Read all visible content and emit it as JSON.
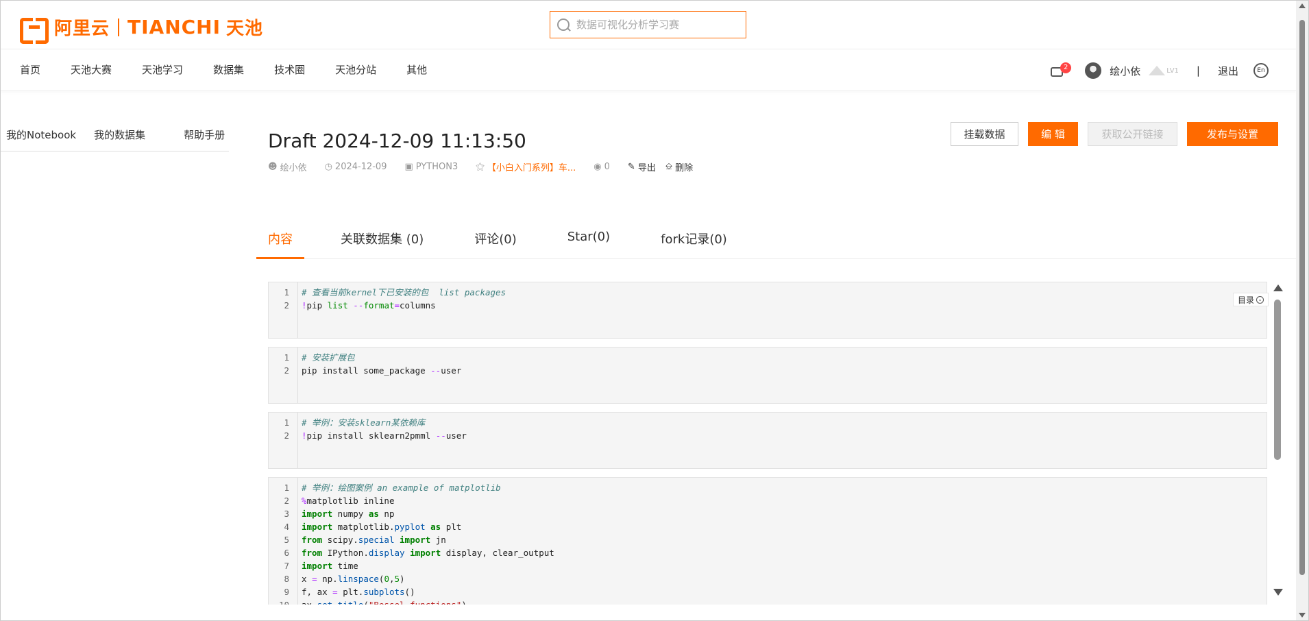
{
  "header": {
    "logo_cn": "阿里云",
    "logo_en": "TIANCHI",
    "logo_en_cn": "天池",
    "search_placeholder": "数据可视化分析学习赛"
  },
  "nav": {
    "items": [
      "首页",
      "天池大赛",
      "天池学习",
      "数据集",
      "技术圈",
      "天池分站",
      "其他"
    ],
    "message_count": "2",
    "username": "绘小依",
    "level": "LV1",
    "divider": "|",
    "logout": "退出",
    "lang": "En"
  },
  "sidebar": {
    "tabs": [
      "我的Notebook",
      "我的数据集",
      "帮助手册"
    ]
  },
  "doc": {
    "title": "Draft 2024-12-09 11:13:50",
    "author": "绘小依",
    "date": "2024-12-09",
    "kernel": "PYTHON3",
    "competition": "【小白入门系列】车...",
    "views": "0",
    "export": "导出",
    "delete": "删除"
  },
  "actions": {
    "mount": "挂载数据",
    "edit": "编 辑",
    "public_link": "获取公开链接",
    "publish": "发布与设置"
  },
  "tabs": [
    "内容",
    "关联数据集 (0)",
    "评论(0)",
    "Star(0)",
    "fork记录(0)"
  ],
  "toc_label": "目录",
  "colors": {
    "accent": "#ff6a00"
  },
  "icons": {
    "author": "user-icon",
    "date": "clock-icon",
    "kernel": "terminal-icon",
    "competition": "trophy-icon",
    "views": "eye-icon",
    "export": "export-icon",
    "delete": "trash-icon"
  },
  "cells": [
    [
      "# 查看当前kernel下已安装的包  list packages",
      "!pip list --format=columns"
    ],
    [
      "# 安装扩展包",
      "pip install some_package --user"
    ],
    [
      "# 举例：安装sklearn某依赖库",
      "!pip install sklearn2pmml --user"
    ],
    [
      "# 举例：绘图案例 an example of matplotlib",
      "%matplotlib inline",
      "import numpy as np",
      "import matplotlib.pyplot as plt",
      "from scipy.special import jn",
      "from IPython.display import display, clear_output",
      "import time",
      "x = np.linspace(0,5)",
      "f, ax = plt.subplots()",
      "ax.set_title(\"Bessel functions\")"
    ]
  ]
}
